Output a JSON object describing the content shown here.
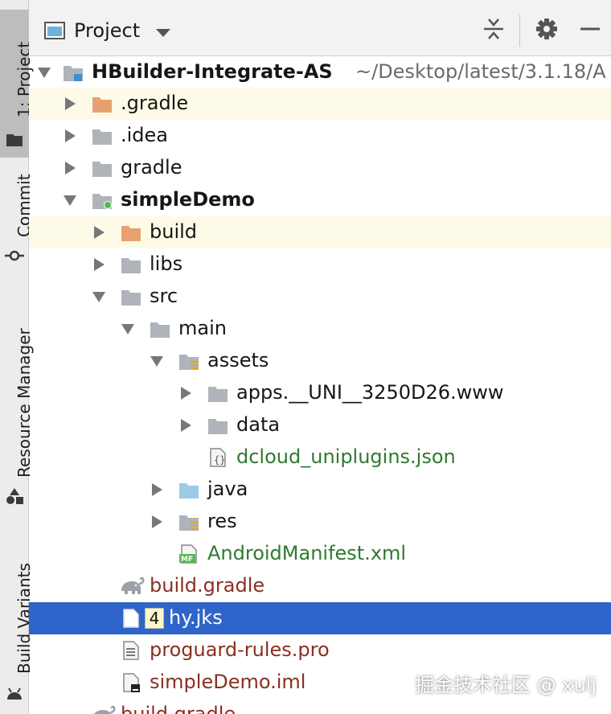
{
  "tool_strip": {
    "tabs": [
      {
        "label": "1: Project"
      },
      {
        "label": "Commit"
      },
      {
        "label": "Resource Manager"
      },
      {
        "label": "Build Variants"
      }
    ]
  },
  "header": {
    "title": "Project"
  },
  "tree": {
    "root": {
      "label": "HBuilder-Integrate-AS",
      "path": "~/Desktop/latest/3.1.18/A"
    },
    "items": {
      "gradle_dir": ".gradle",
      "idea_dir": ".idea",
      "gradle": "gradle",
      "simpledemo": "simpleDemo",
      "build": "build",
      "libs": "libs",
      "src": "src",
      "main": "main",
      "assets": "assets",
      "apps": "apps.__UNI__3250D26.www",
      "data": "data",
      "dcloud": "dcloud_uniplugins.json",
      "java": "java",
      "res": "res",
      "manifest": "AndroidManifest.xml",
      "build_gradle": "build.gradle",
      "hy_badge": "4",
      "hy_jks": "hy.jks",
      "proguard": "proguard-rules.pro",
      "simpledemo_iml": "simpleDemo.iml",
      "root_build_gradle": "build.gradle"
    }
  },
  "watermark": "掘金技术社区 @ xulj",
  "colors": {
    "selection": "#2f65ca",
    "highlight_row": "#fdfbe7",
    "excluded_folder": "#e9a070",
    "folder": "#aeb4b9",
    "source_folder": "#9ccbe8",
    "green_text": "#2f7a2f",
    "gradle_text": "#8a2f22"
  }
}
